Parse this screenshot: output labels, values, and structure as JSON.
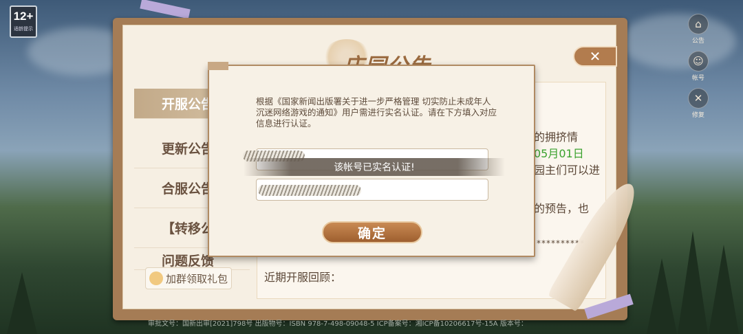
{
  "age_badge": {
    "rating": "12+",
    "label": "适龄提示"
  },
  "side_buttons": [
    {
      "icon": "announcement-icon",
      "label": "公告"
    },
    {
      "icon": "account-icon",
      "label": "帐号"
    },
    {
      "icon": "repair-icon",
      "label": "修复"
    }
  ],
  "board": {
    "title": "庄园公告",
    "close_icon": "close-icon",
    "tabs": [
      {
        "label": "开服公告",
        "active": true
      },
      {
        "label": "更新公告",
        "active": false
      },
      {
        "label": "合服公告",
        "active": false
      },
      {
        "label": "【转移公告",
        "active": false
      },
      {
        "label": "问题反馈",
        "active": false
      }
    ],
    "qq_group_button": "加群领取礼包",
    "content_fragments": {
      "line1": "的拥挤情",
      "date": "05月01日",
      "line3": "园主们可以进",
      "line4": "的预告，也",
      "masked": "**********",
      "history_title": "近期开服回顾："
    }
  },
  "footer": "审批文号：国新出审[2021]798号 出版物号：ISBN 978-7-498-09048-5 ICP备案号：湘ICP备10206617号-15A 版本号：",
  "dialog": {
    "notice": "根据《国家新闻出版署关于进一步严格管理 切实防止未成年人沉迷网络游戏的通知》用户需进行实名认证。请在下方填入对应信息进行认证。",
    "toast": "该帐号已实名认证!",
    "confirm_label": "确定"
  }
}
